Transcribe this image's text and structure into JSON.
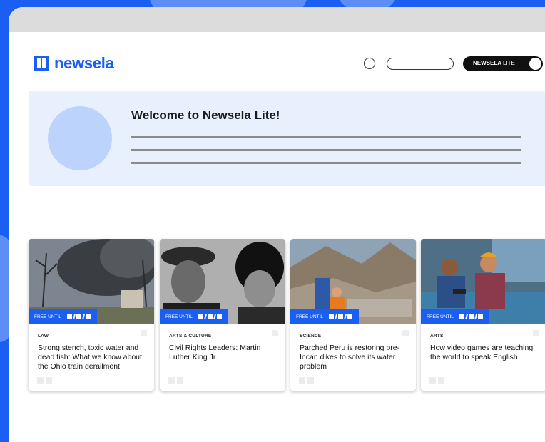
{
  "colors": {
    "brand": "#1a5ff2",
    "banner": "#e8f0fe",
    "background": "#1a5ff2"
  },
  "header": {
    "logo_text": "newsela",
    "toggle_label": "NEWSELA",
    "toggle_label_suffix": "LITE"
  },
  "banner": {
    "title": "Welcome to Newsela Lite!"
  },
  "cards": [
    {
      "badge": "FREE UNTIL",
      "category": "LAW",
      "headline": "Strong stench, toxic water and dead fish: What we know about the Ohio train derailment"
    },
    {
      "badge": "FREE UNTIL",
      "category": "ARTS & CULTURE",
      "headline": "Civil Rights Leaders: Martin Luther King Jr."
    },
    {
      "badge": "FREE UNTIL",
      "category": "SCIENCE",
      "headline": "Parched Peru is restoring pre-Incan dikes to solve its water problem"
    },
    {
      "badge": "FREE UNTIL",
      "category": "ARTS",
      "headline": "How video games are teaching the world to speak English"
    }
  ]
}
